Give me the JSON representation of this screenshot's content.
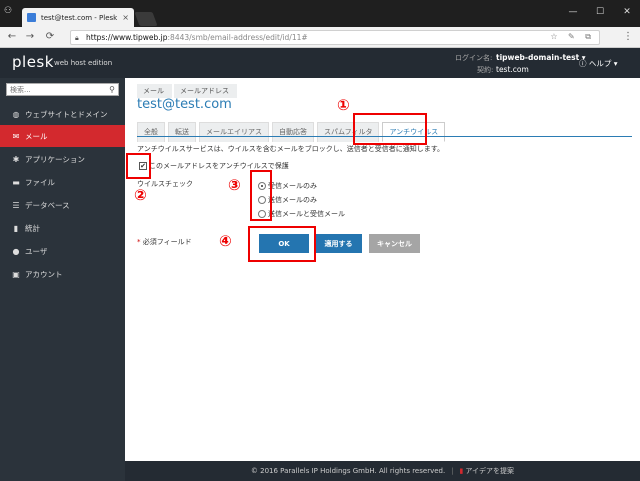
{
  "browser": {
    "tab_title": "test@test.com - Plesk 1",
    "tab_close": "×",
    "url_host": "https://www.tipweb.jp",
    "url_rest": ":8443/smb/email-address/edit/id/11#",
    "omni_icons": "☆ ✎ ⧉",
    "win_min": "—",
    "win_max": "☐",
    "win_close": "✕",
    "back": "←",
    "forward": "→",
    "reload": "⟳",
    "menu": "⋮"
  },
  "header": {
    "logo": "plesk",
    "logo_sub": "web host edition",
    "login_label": "ログイン名:",
    "login_user": "tipweb-domain-test ▾",
    "contract_label": "契約:",
    "contract_value": "test.com",
    "help": "ⓘ ヘルプ ▾"
  },
  "sidebar": {
    "search_placeholder": "検索...",
    "items": [
      {
        "icon": "◍",
        "label": "ウェブサイトとドメイン"
      },
      {
        "icon": "✉",
        "label": "メール"
      },
      {
        "icon": "✱",
        "label": "アプリケーション"
      },
      {
        "icon": "▬",
        "label": "ファイル"
      },
      {
        "icon": "☰",
        "label": "データベース"
      },
      {
        "icon": "▮",
        "label": "統計"
      },
      {
        "icon": "●",
        "label": "ユーザ"
      },
      {
        "icon": "▣",
        "label": "アカウント"
      }
    ]
  },
  "main": {
    "breadcrumb": [
      "メール",
      "メールアドレス"
    ],
    "title": "test@test.com",
    "tabs": [
      "全般",
      "転送",
      "メールエイリアス",
      "自動応答",
      "スパムフィルタ",
      "アンチウイルス"
    ],
    "description": "アンチウイルスサービスは、ウイルスを含むメールをブロックし、送信者と受信者に通知します。",
    "checkbox_label": "このメールアドレスをアンチウイルスで保護",
    "check_label": "ウイルスチェック",
    "radios": [
      "受信メールのみ",
      "送信メールのみ",
      "送信メールと受信メール"
    ],
    "required_star": "*",
    "required_label": "必須フィールド",
    "ok": "OK",
    "apply": "適用する",
    "cancel": "キャンセル"
  },
  "footer": {
    "copyright": "© 2016 Parallels IP Holdings GmbH. All rights reserved.",
    "sep": "|",
    "idea": "アイデアを提案"
  },
  "annotations": [
    "①",
    "②",
    "③",
    "④"
  ]
}
